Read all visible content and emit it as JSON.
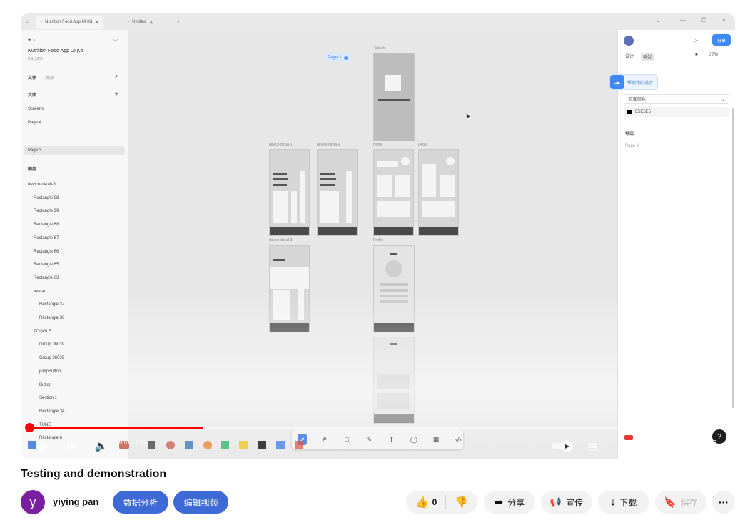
{
  "player": {
    "app": {
      "tabs": [
        {
          "label": "Nutrition Food App UI Kit"
        },
        {
          "label": "Untitled"
        }
      ],
      "home_icon": "home-icon",
      "left_panel": {
        "file_title": "Nutrition Food App UI Kit",
        "file_sub": "DG_UI06",
        "tab_file": "文件",
        "tab_assets": "资源",
        "pages_header": "页面",
        "pages": [
          "Screens",
          "Page 4",
          "Page 3"
        ],
        "layers_header": "图层",
        "layers": [
          "device-detail-6",
          "Rectangle 98",
          "Rectangle 99",
          "Rectangle 68",
          "Rectangle 67",
          "Rectangle 66",
          "Rectangle 65",
          "Rectangle 63",
          "avatar",
          "Rectangle 37",
          "Rectangle 36",
          "TOGGLE",
          "Group 36039",
          "Group 36039",
          "jumpButton",
          "Button",
          "Section 1",
          "Rectangle 34",
          "TUNE",
          "Rectangle 6"
        ]
      },
      "right_panel": {
        "share_label": "分享",
        "zoom": "37%",
        "tab_design": "设计",
        "tab_prototype": "原型",
        "ai_badge": "帮助我的设计",
        "dropdown_value": "页面颜色",
        "color_hex": "E5E5E5",
        "section_export": "导出",
        "page_label": "Page 3"
      },
      "canvas": {
        "page_badge": "Page 3",
        "frame_labels": [
          "Splash",
          "device-detail-1",
          "device-detail-2",
          "Home",
          "Detail",
          "device-detail-3",
          "Profile"
        ]
      },
      "toolbar_icons": [
        "move-icon",
        "frame-icon",
        "shape-icon",
        "pen-icon",
        "text-icon",
        "comment-icon",
        "component-icon",
        "dev-mode-icon"
      ]
    },
    "progress": 0.25,
    "time": "0:01 / 1:21",
    "controls": [
      "play-icon",
      "next-icon",
      "volume-icon",
      "autoplay-toggle",
      "subtitles-icon",
      "settings-icon",
      "miniplayer-icon",
      "theater-icon",
      "fullscreen-icon"
    ]
  },
  "video": {
    "title": "Testing and demonstration",
    "channel": "yiying pan",
    "avatar_letter": "y",
    "analytics_btn": "数据分析",
    "edit_btn": "编辑视频",
    "likes": "0",
    "share": "分享",
    "promote": "宣传",
    "download": "下载",
    "save": "保存"
  },
  "colors": {
    "avatar": "#7b1fa2",
    "primary_button": "#3d6ad6",
    "progress": "#ff0000"
  }
}
